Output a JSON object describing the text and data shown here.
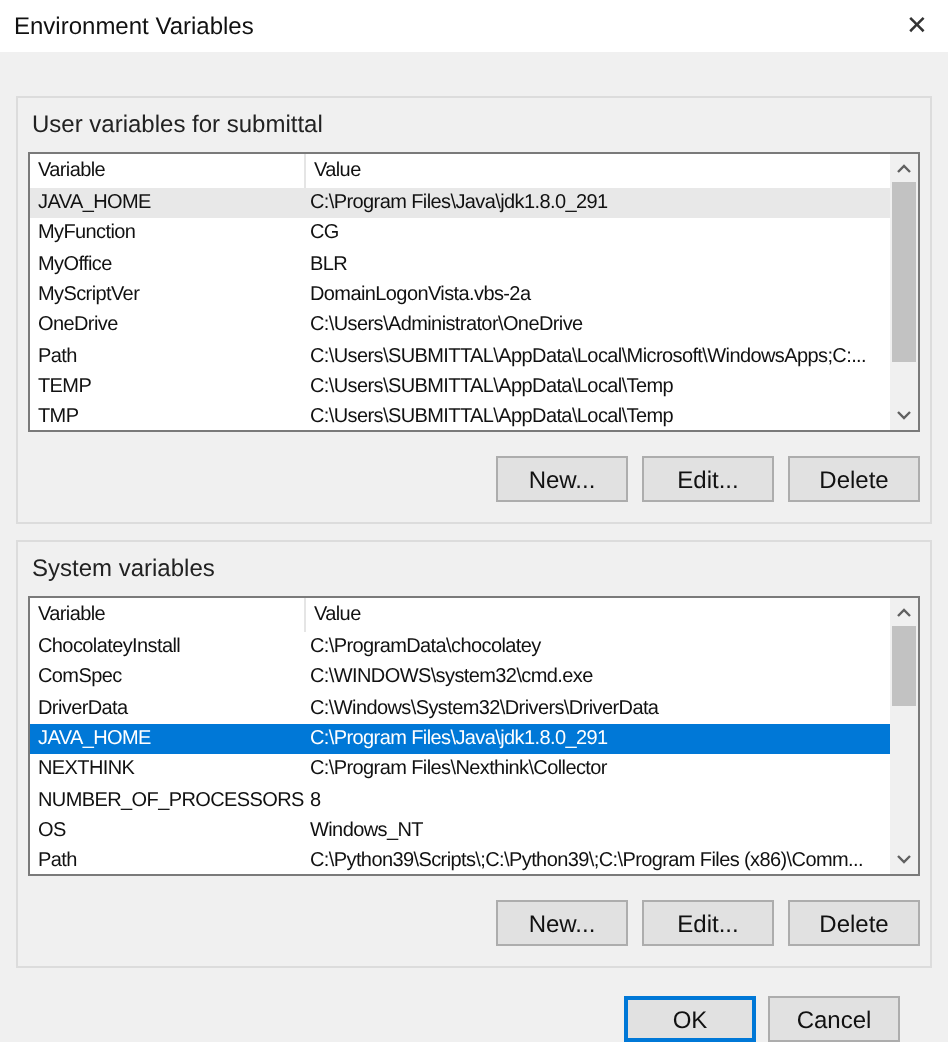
{
  "window": {
    "title": "Environment Variables",
    "close": "✕"
  },
  "groups": [
    {
      "title": "User variables for submittal",
      "focused": false,
      "columns": [
        "Variable",
        "Value"
      ],
      "rows": [
        {
          "name": "JAVA_HOME",
          "value": "C:\\Program Files\\Java\\jdk1.8.0_291",
          "selected": true
        },
        {
          "name": "MyFunction",
          "value": "CG",
          "selected": false
        },
        {
          "name": "MyOffice",
          "value": "BLR",
          "selected": false
        },
        {
          "name": "MyScriptVer",
          "value": "DomainLogonVista.vbs-2a",
          "selected": false
        },
        {
          "name": "OneDrive",
          "value": "C:\\Users\\Administrator\\OneDrive",
          "selected": false
        },
        {
          "name": "Path",
          "value": "C:\\Users\\SUBMITTAL\\AppData\\Local\\Microsoft\\WindowsApps;C:...",
          "selected": false
        },
        {
          "name": "TEMP",
          "value": "C:\\Users\\SUBMITTAL\\AppData\\Local\\Temp",
          "selected": false
        },
        {
          "name": "TMP",
          "value": "C:\\Users\\SUBMITTAL\\AppData\\Local\\Temp",
          "selected": false
        }
      ],
      "buttons": [
        "New...",
        "Edit...",
        "Delete"
      ]
    },
    {
      "title": "System variables",
      "focused": true,
      "columns": [
        "Variable",
        "Value"
      ],
      "rows": [
        {
          "name": "ChocolateyInstall",
          "value": "C:\\ProgramData\\chocolatey",
          "selected": false
        },
        {
          "name": "ComSpec",
          "value": "C:\\WINDOWS\\system32\\cmd.exe",
          "selected": false
        },
        {
          "name": "DriverData",
          "value": "C:\\Windows\\System32\\Drivers\\DriverData",
          "selected": false
        },
        {
          "name": "JAVA_HOME",
          "value": "C:\\Program Files\\Java\\jdk1.8.0_291",
          "selected": true
        },
        {
          "name": "NEXTHINK",
          "value": "C:\\Program Files\\Nexthink\\Collector",
          "selected": false
        },
        {
          "name": "NUMBER_OF_PROCESSORS",
          "value": "8",
          "selected": false
        },
        {
          "name": "OS",
          "value": "Windows_NT",
          "selected": false
        },
        {
          "name": "Path",
          "value": "C:\\Python39\\Scripts\\;C:\\Python39\\;C:\\Program Files (x86)\\Comm...",
          "selected": false
        }
      ],
      "buttons": [
        "New...",
        "Edit...",
        "Delete"
      ]
    }
  ],
  "footer_buttons": [
    {
      "label": "OK",
      "default": true
    },
    {
      "label": "Cancel",
      "default": false
    }
  ]
}
